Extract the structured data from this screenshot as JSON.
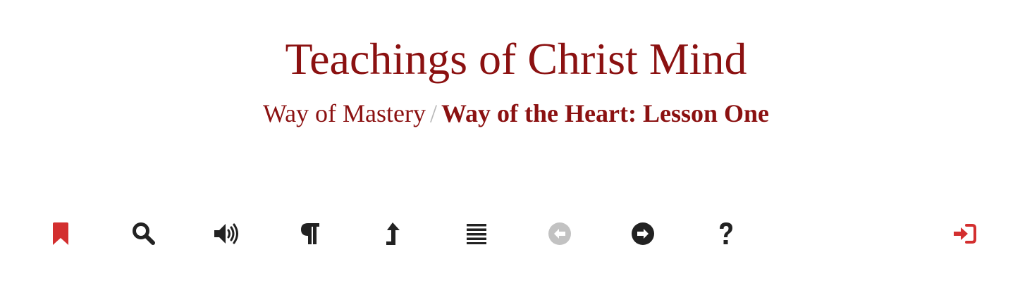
{
  "header": {
    "site_title": "Teachings of Christ Mind",
    "breadcrumb": {
      "parent": "Way of Mastery",
      "separator": "/",
      "current": "Way of the Heart: Lesson One"
    }
  },
  "toolbar": {
    "items": [
      {
        "name": "bookmark",
        "icon": "bookmark-icon",
        "color": "#d32f2f"
      },
      {
        "name": "search",
        "icon": "search-icon",
        "color": "#222222"
      },
      {
        "name": "audio",
        "icon": "volume-up-icon",
        "color": "#222222"
      },
      {
        "name": "paragraph",
        "icon": "paragraph-icon",
        "color": "#222222"
      },
      {
        "name": "level-up",
        "icon": "level-up-icon",
        "color": "#222222"
      },
      {
        "name": "contents",
        "icon": "list-icon",
        "color": "#222222"
      },
      {
        "name": "previous",
        "icon": "arrow-circle-left-icon",
        "color": "#c2c2c2",
        "disabled": true
      },
      {
        "name": "next",
        "icon": "arrow-circle-right-icon",
        "color": "#222222"
      },
      {
        "name": "help",
        "icon": "question-icon",
        "color": "#222222"
      },
      {
        "name": "sign-in",
        "icon": "sign-in-icon",
        "color": "#d32f2f"
      }
    ]
  },
  "colors": {
    "title": "#8b1111",
    "separator": "#b8b8b8",
    "accent": "#d32f2f",
    "icon": "#222222",
    "disabled": "#c2c2c2"
  }
}
